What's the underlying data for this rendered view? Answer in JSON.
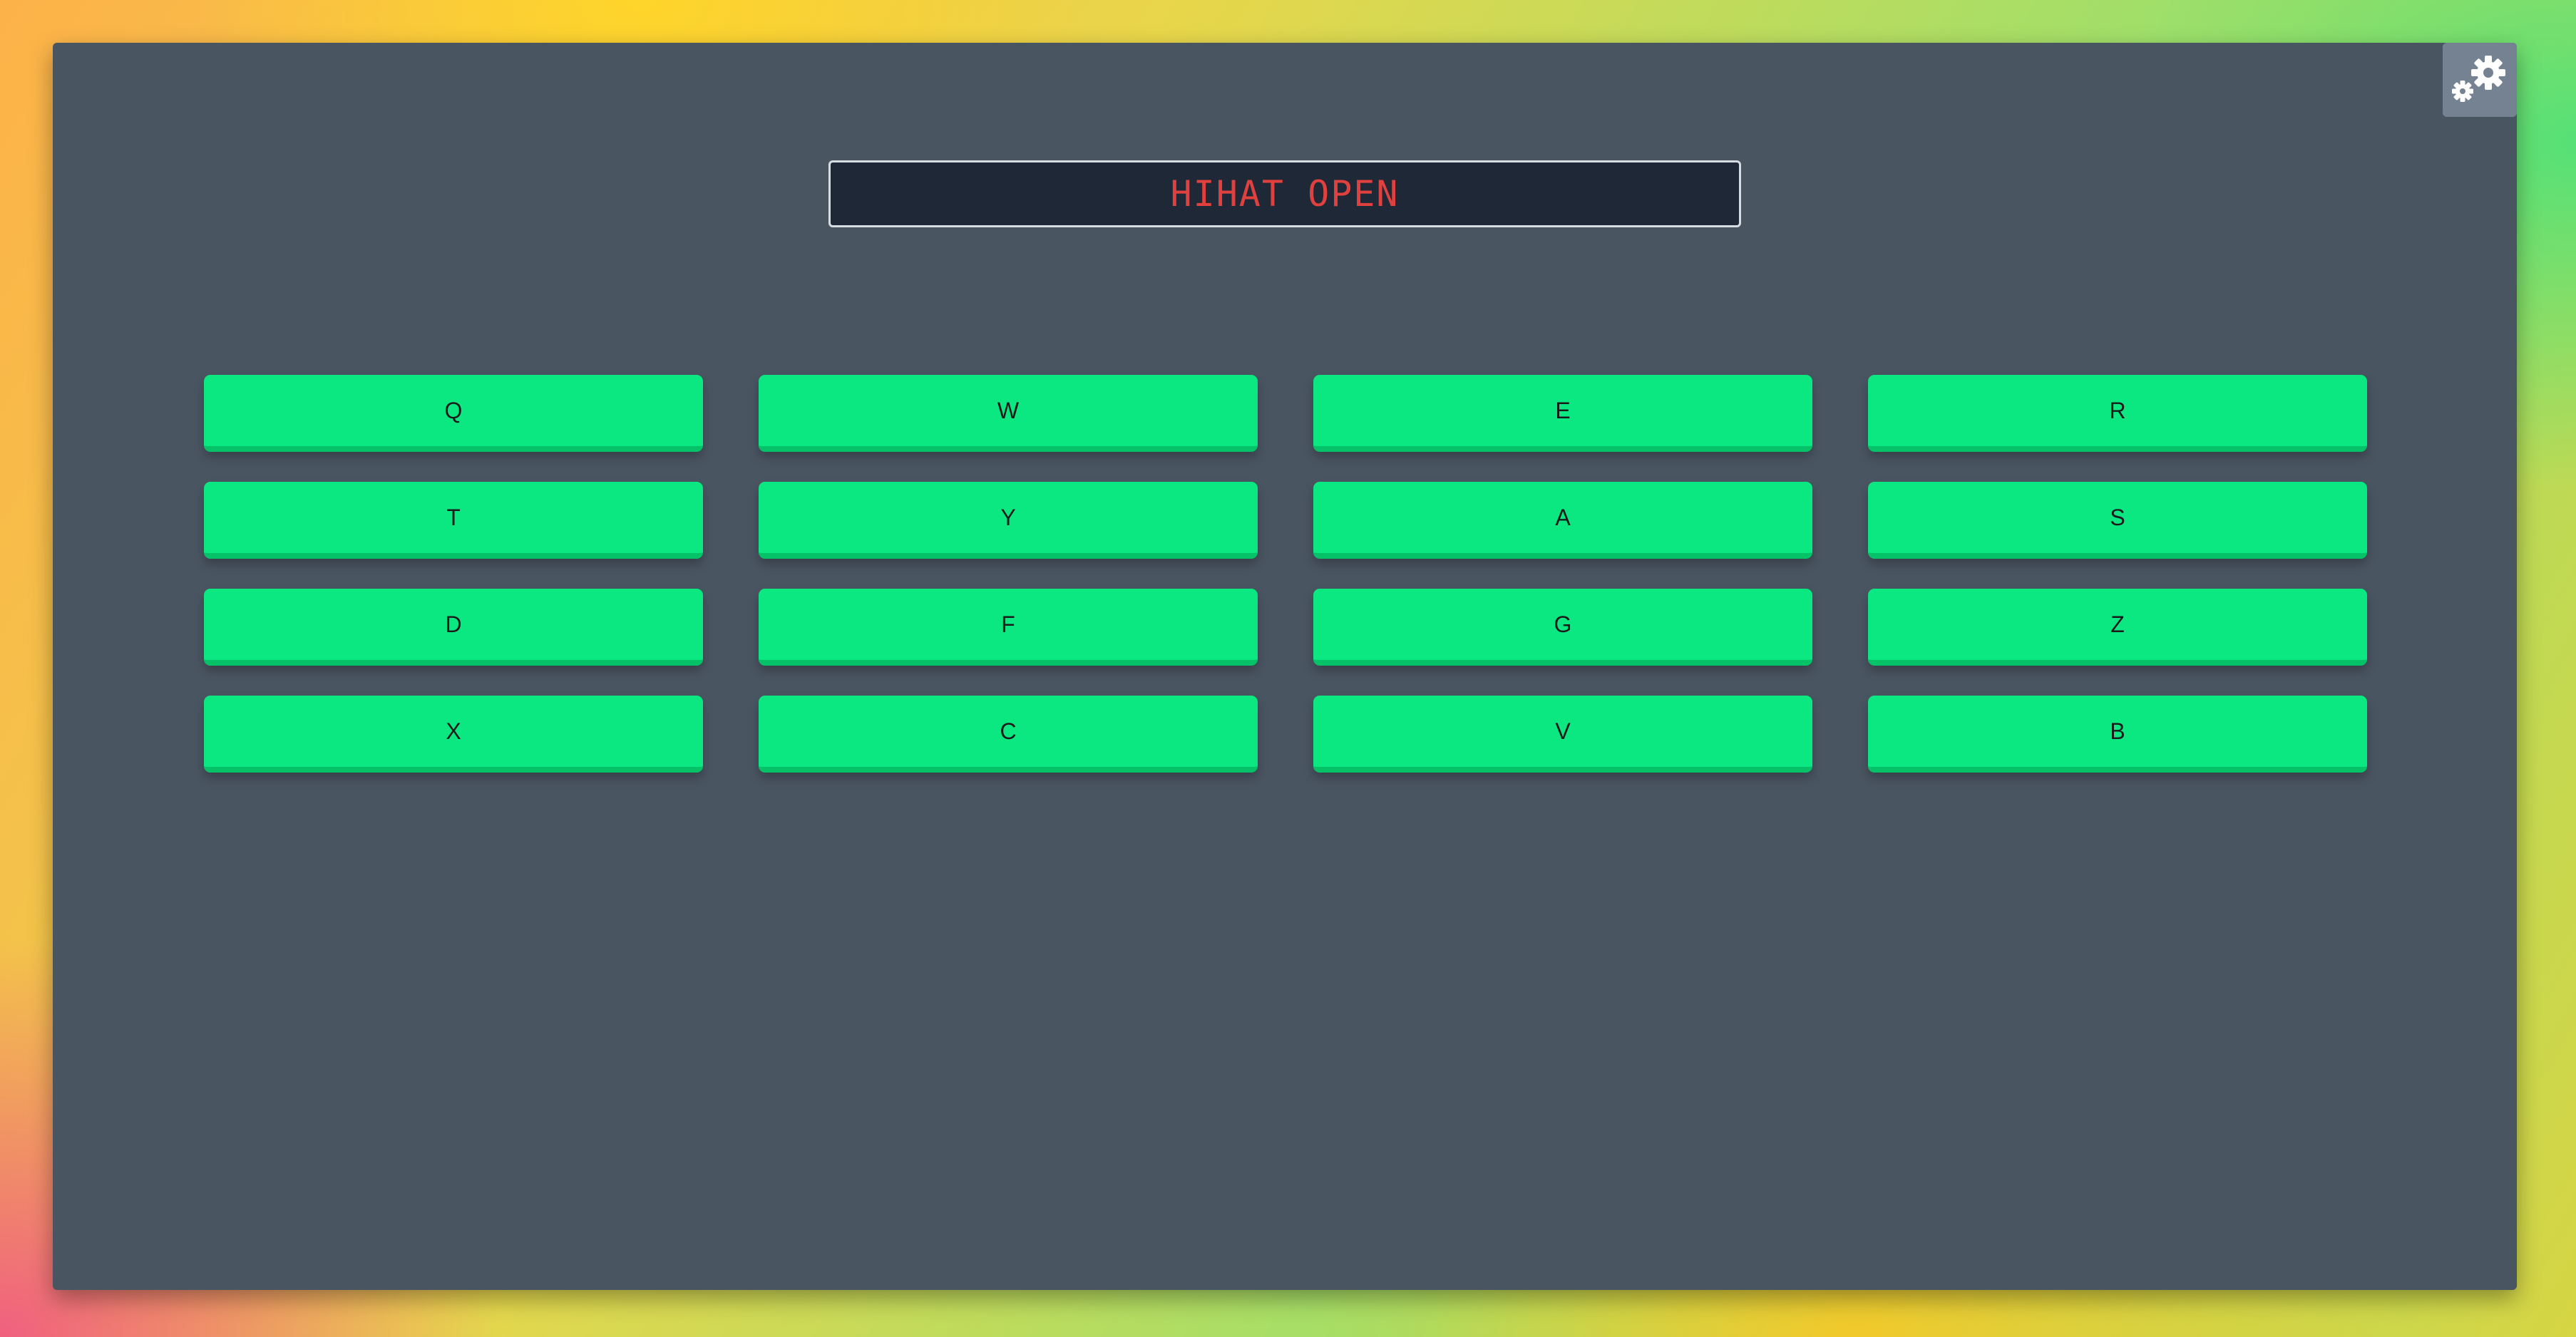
{
  "display": {
    "text": "HIHAT OPEN"
  },
  "settings": {
    "icon": "gears-icon"
  },
  "colors": {
    "panel": "#4a5562",
    "pad": "#0be881",
    "display_text": "#e0413e",
    "display_bg": "#1f2836"
  },
  "pads": [
    {
      "key": "Q"
    },
    {
      "key": "W"
    },
    {
      "key": "E"
    },
    {
      "key": "R"
    },
    {
      "key": "T"
    },
    {
      "key": "Y"
    },
    {
      "key": "A"
    },
    {
      "key": "S"
    },
    {
      "key": "D"
    },
    {
      "key": "F"
    },
    {
      "key": "G"
    },
    {
      "key": "Z"
    },
    {
      "key": "X"
    },
    {
      "key": "C"
    },
    {
      "key": "V"
    },
    {
      "key": "B"
    }
  ]
}
